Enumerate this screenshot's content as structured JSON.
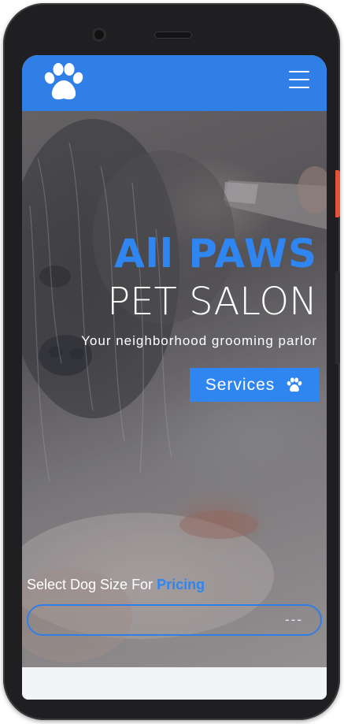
{
  "navbar": {
    "logo_icon": "paw-icon",
    "menu_icon": "hamburger-menu-icon"
  },
  "hero": {
    "title_line1": "All PAWS",
    "title_line2": "PET SALON",
    "tagline": "Your neighborhood grooming parlor",
    "services_button": "Services",
    "services_icon": "paw-icon"
  },
  "pricing": {
    "label_prefix": "Select Dog Size For ",
    "label_highlight": "Pricing",
    "select_value": "---"
  },
  "colors": {
    "brand_blue": "#2f7fe6",
    "accent_blue": "#2f86f0",
    "phone_frame": "#1f1f21"
  }
}
